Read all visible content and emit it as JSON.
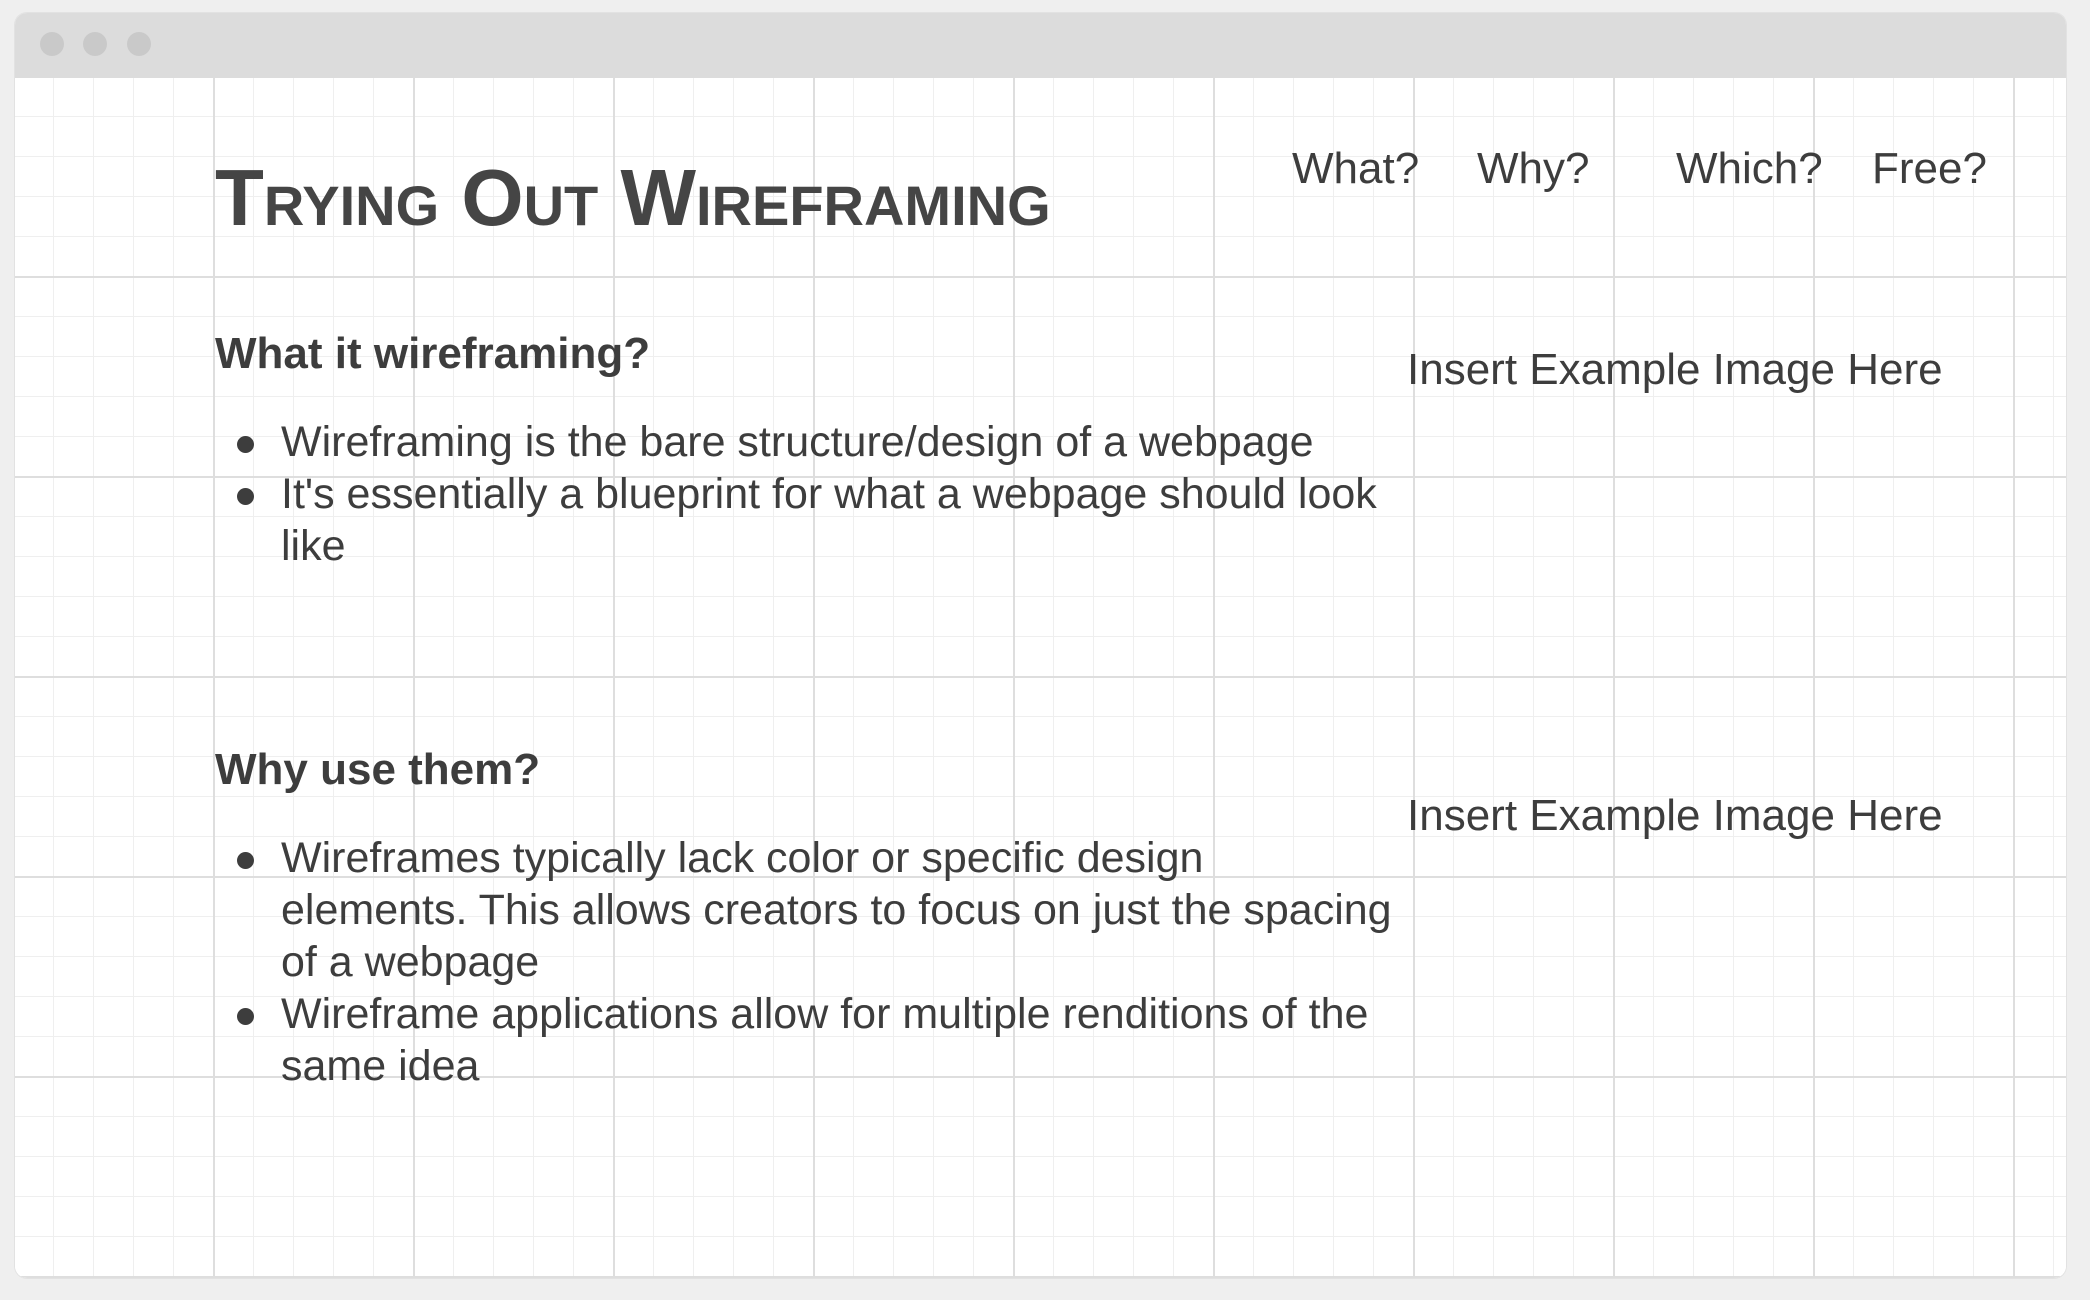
{
  "site": {
    "title": "Trying Out Wireframing"
  },
  "nav": {
    "items": [
      {
        "label": "What?"
      },
      {
        "label": "Why?"
      },
      {
        "label": "Which?"
      },
      {
        "label": "Free?"
      }
    ]
  },
  "sections": [
    {
      "heading": "What it wireframing?",
      "bullets": [
        "Wireframing is the bare structure/design of a webpage",
        "It's essentially a blueprint for what a webpage should look like"
      ],
      "image_placeholder": "Insert Example Image Here"
    },
    {
      "heading": "Why use them?",
      "bullets": [
        "Wireframes typically lack color or specific design elements. This allows creators to focus on just the spacing of a webpage",
        "Wireframe applications allow for multiple renditions of the same idea"
      ],
      "image_placeholder": "Insert Example Image Here"
    }
  ],
  "colors": {
    "text": "#3d3d3d",
    "titlebar": "#dcdcdc",
    "grid_major": "#dedede",
    "grid_minor": "#efefef"
  }
}
